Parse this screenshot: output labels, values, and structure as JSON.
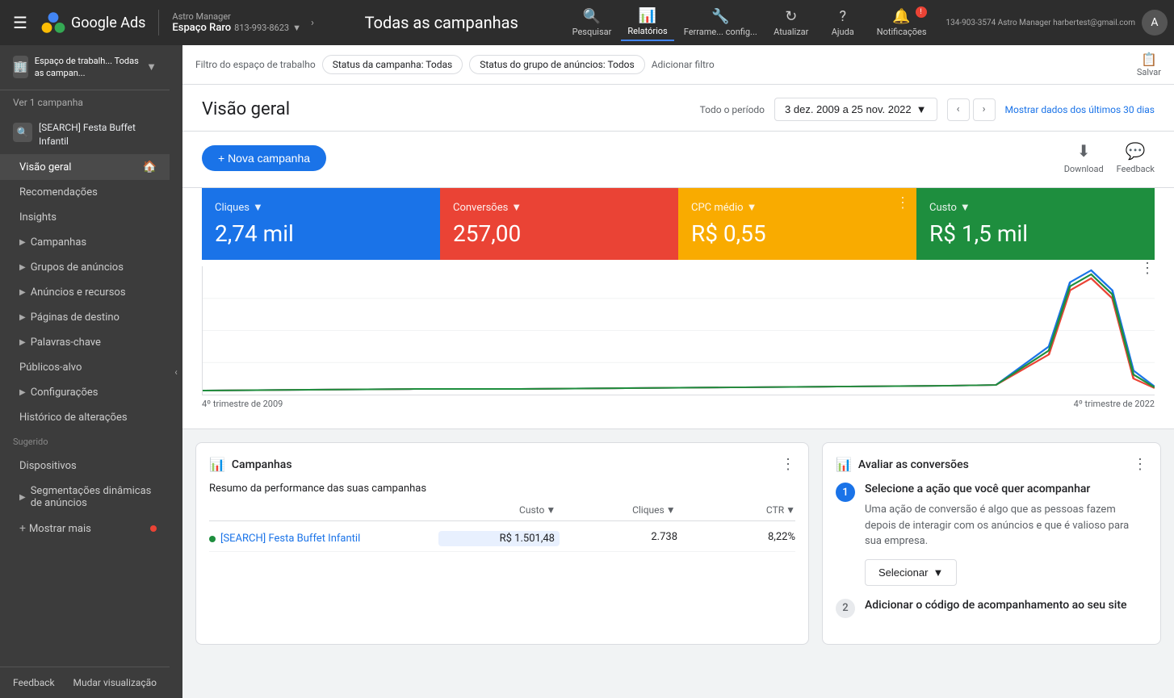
{
  "topNav": {
    "hamburger": "☰",
    "logoText": "Google Ads",
    "accountParent": "Astro Manager",
    "accountName": "Espaço Raro",
    "accountId": "813-993-8623",
    "campaignTitle": "Todas as campanhas",
    "navItems": [
      {
        "id": "search",
        "label": "Pesquisar",
        "icon": "🔍"
      },
      {
        "id": "reports",
        "label": "Relatórios",
        "icon": "📊",
        "active": true
      },
      {
        "id": "tools",
        "label": "Ferrame... config...",
        "icon": "🔧"
      },
      {
        "id": "refresh",
        "label": "Atualizar",
        "icon": "↻"
      },
      {
        "id": "help",
        "label": "Ajuda",
        "icon": "?"
      },
      {
        "id": "notifications",
        "label": "Notificações",
        "icon": "🔔"
      }
    ],
    "accountRight": "134-903-3574 Astro Manager\nharbertest@gmail.com"
  },
  "sidebar": {
    "workspaceLabel": "Espaço de trabalh...\nTodas as campan...",
    "viewCampaign": "Ver 1 campanha",
    "campaignName": "[SEARCH] Festa Buffet Infantil",
    "navItems": [
      {
        "id": "overview",
        "label": "Visão geral",
        "active": true,
        "hasHome": true
      },
      {
        "id": "recommendations",
        "label": "Recomendações"
      },
      {
        "id": "insights",
        "label": "Insights"
      },
      {
        "id": "campaigns",
        "label": "Campanhas",
        "hasArrow": true
      },
      {
        "id": "ad-groups",
        "label": "Grupos de anúncios",
        "hasArrow": true
      },
      {
        "id": "ads-resources",
        "label": "Anúncios e recursos",
        "hasArrow": true
      },
      {
        "id": "landing-pages",
        "label": "Páginas de destino",
        "hasArrow": true
      },
      {
        "id": "keywords",
        "label": "Palavras-chave",
        "hasArrow": true
      },
      {
        "id": "audiences",
        "label": "Públicos-alvo"
      },
      {
        "id": "settings",
        "label": "Configurações",
        "hasArrow": true
      },
      {
        "id": "history",
        "label": "Histórico de alterações"
      }
    ],
    "sectionLabel": "Sugerido",
    "suggestedItems": [
      {
        "id": "devices",
        "label": "Dispositivos"
      },
      {
        "id": "dynamic-segments",
        "label": "Segmentações dinâmicas de anúncios",
        "hasArrow": true
      }
    ],
    "showMore": "Mostrar mais",
    "feedbackBtn": "Feedback",
    "changeView": "Mudar\nvisualização"
  },
  "filterBar": {
    "label": "Filtro do espaço de trabalho",
    "chips": [
      "Status da campanha: Todas",
      "Status do grupo de anúncios: Todos"
    ],
    "addFilter": "Adicionar filtro",
    "saveLabel": "Salvar"
  },
  "overview": {
    "title": "Visão geral",
    "periodLabel": "Todo o período",
    "dateRange": "3 dez. 2009 a 25 nov. 2022",
    "showLast30": "Mostrar dados dos últimos 30 dias",
    "newCampaignBtn": "+ Nova campanha",
    "downloadLabel": "Download",
    "feedbackLabel": "Feedback",
    "metrics": [
      {
        "id": "clicks",
        "label": "Cliques",
        "value": "2,74 mil",
        "color": "blue"
      },
      {
        "id": "conversions",
        "label": "Conversões",
        "value": "257,00",
        "color": "red"
      },
      {
        "id": "cpc",
        "label": "CPC médio",
        "value": "R$ 0,55",
        "color": "yellow"
      },
      {
        "id": "cost",
        "label": "Custo",
        "value": "R$ 1,5 mil",
        "color": "green"
      }
    ],
    "chartLabels": {
      "left": "4º trimestre de 2009",
      "right": "4º trimestre de 2022"
    }
  },
  "campaignsPanel": {
    "title": "Campanhas",
    "subtitle": "Resumo da performance das suas campanhas",
    "columns": [
      {
        "label": "Custo",
        "sortable": true
      },
      {
        "label": "Cliques",
        "sortable": true
      },
      {
        "label": "CTR",
        "sortable": true
      }
    ],
    "rows": [
      {
        "name": "[SEARCH] Festa Buffet Infantil",
        "status": "active",
        "cost": "R$ 1.501,48",
        "clicks": "2.738",
        "ctr": "8,22%"
      }
    ]
  },
  "conversionsPanel": {
    "title": "Avaliar as conversões",
    "step1": {
      "number": "1",
      "title": "Selecione a ação que você quer acompanhar",
      "description": "Uma ação de conversão é algo que as pessoas fazem depois de interagir com os anúncios e que é valioso para sua empresa.",
      "selectLabel": "Selecionar"
    },
    "step2": {
      "number": "2",
      "title": "Adicionar o código de acompanhamento ao seu site"
    }
  }
}
